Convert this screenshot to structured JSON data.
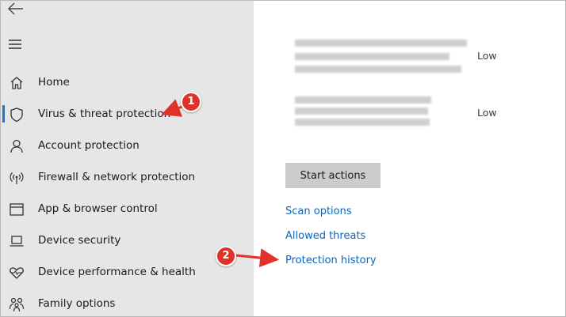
{
  "sidebar": {
    "items": [
      {
        "label": "Home",
        "icon": "home-icon"
      },
      {
        "label": "Virus & threat protection",
        "icon": "shield-icon",
        "active": true
      },
      {
        "label": "Account protection",
        "icon": "person-icon"
      },
      {
        "label": "Firewall & network protection",
        "icon": "wifi-signal-icon"
      },
      {
        "label": "App & browser control",
        "icon": "window-icon"
      },
      {
        "label": "Device security",
        "icon": "laptop-icon"
      },
      {
        "label": "Device performance & health",
        "icon": "heart-pulse-icon"
      },
      {
        "label": "Family options",
        "icon": "family-icon"
      }
    ]
  },
  "threats": [
    {
      "level": "Low"
    },
    {
      "level": "Low"
    }
  ],
  "main": {
    "start_actions": "Start actions",
    "links": [
      "Scan options",
      "Allowed threats",
      "Protection history"
    ]
  },
  "annotations": {
    "step1": "1",
    "step2": "2"
  },
  "colors": {
    "accent": "#1a73d9",
    "link": "#0a66c2",
    "annotation": "#e0322b",
    "sidebar_bg": "#e6e6e6"
  }
}
